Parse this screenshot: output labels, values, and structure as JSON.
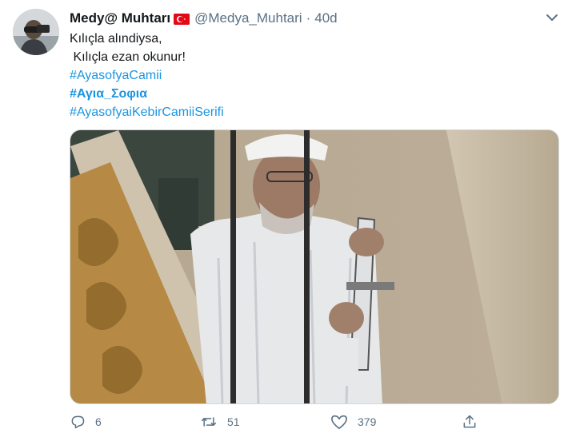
{
  "tweet": {
    "display_name": "Medy@ Muhtarı",
    "handle": "@Medya_Muhtari",
    "separator": "·",
    "time": "40d",
    "lines": [
      {
        "text": "Kılıçla alındiysa,",
        "type": "text"
      },
      {
        "text": " Kılıçla ezan okunur!",
        "type": "text"
      },
      {
        "text": "#AyasofyaCamii",
        "type": "hashtag"
      },
      {
        "text": "#Αγια_Σοφια",
        "type": "hashtag-bold"
      },
      {
        "text": "#AyasofyaiKebirCamiiSerifi",
        "type": "hashtag"
      }
    ],
    "stats": {
      "replies": "6",
      "retweets": "51",
      "likes": "379"
    },
    "icons": {
      "flag": "turkey-flag-icon",
      "more": "chevron-down-icon",
      "reply": "reply-icon",
      "retweet": "retweet-icon",
      "like": "heart-icon",
      "share": "share-icon"
    },
    "colors": {
      "link": "#1b95e0",
      "muted": "#5b7083",
      "flag_red": "#e30a17"
    }
  }
}
